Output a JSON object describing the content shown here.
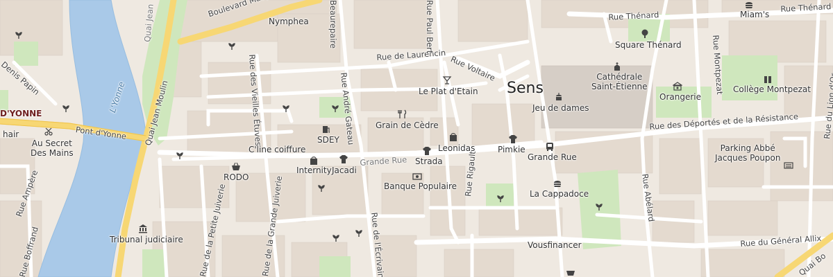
{
  "map": {
    "city_label": "Sens",
    "streets": {
      "boulevard_maupeou": "Boulevard Maupeou",
      "rue_laurencin": "Rue de Laurencin",
      "rue_voltaire": "Rue Voltaire",
      "rue_paul_bert": "Rue Paul Bert",
      "rue_beaurepaire": "Beaurepaire",
      "rue_andre_gateau": "Rue André Gateau",
      "rue_vieilles_etuves": "Rue des Vieilles Étuves",
      "grande_rue": "Grande Rue",
      "rue_deportes": "Rue des Déportés et de la Résistance",
      "rue_thenard_1": "Rue Thénard",
      "rue_thenard_2": "Rue Thénard",
      "rue_montpezat": "Rue Montpezat",
      "rue_abelard": "Rue Abélard",
      "rue_rigault": "Rue Rigault",
      "rue_ecrivain": "Rue de l'Écrivain",
      "rue_petite_juiverie": "Rue de la Petite Juiverie",
      "rue_grande_juiverie": "Rue de la Grande Juiverie",
      "rue_general_allix": "Rue du Général Allix",
      "rue_ampere": "Rue Ampère",
      "rue_boffrand": "Rue Boffrand",
      "rue_denis_papin": "Denis Papin",
      "quai_jean_moulin": "Quai Jean Moulin",
      "quai_jean_moulin_top": "Quai Jean",
      "pont_yonne": "Pont d'Yonne",
      "quai_bottom_right": "Quai Bo",
      "rue_lion_or": "Rue du Lion d'Or",
      "yonne_label": "D'YONNE"
    },
    "water": {
      "river_name": "L'Yonne"
    },
    "pois": {
      "nymphea": "Nymphea",
      "plat_etain": "Le Plat d'Etain",
      "grain_cedre": "Grain de Cèdre",
      "sdey": "SDEY",
      "cline": "C'line coiffure",
      "internity": "Internity",
      "jacadi": "Jacadi",
      "rodo": "RODO",
      "leonidas": "Leonidas",
      "strada": "Strada",
      "pimkie": "Pimkie",
      "grande_rue_bus": "Grande Rue",
      "banque_populaire": "Banque Populaire",
      "la_cappadoce": "La Cappadoce",
      "vousfinancer": "Vousfinancer",
      "tribunal": "Tribunal judiciaire",
      "secret_mains": "Au Secret\nDes Mains",
      "hair": "hair",
      "miams": "Miam's",
      "square_thenard": "Square Thénard",
      "cathedrale": "Cathédrale\nSaint-Étienne",
      "orangerie": "Orangerie",
      "jeu_dames": "Jeu de dames",
      "college": "Collège Montpezat",
      "parking": "Parking Abbé\nJacques Poupon"
    },
    "colors": {
      "background": "#efe9e1",
      "building": "#e3d9cf",
      "road": "#ffffff",
      "major_road": "#fbe3a0",
      "river": "#a9c9e8",
      "park": "#cce8bf",
      "poi_icon": "#444444"
    }
  }
}
